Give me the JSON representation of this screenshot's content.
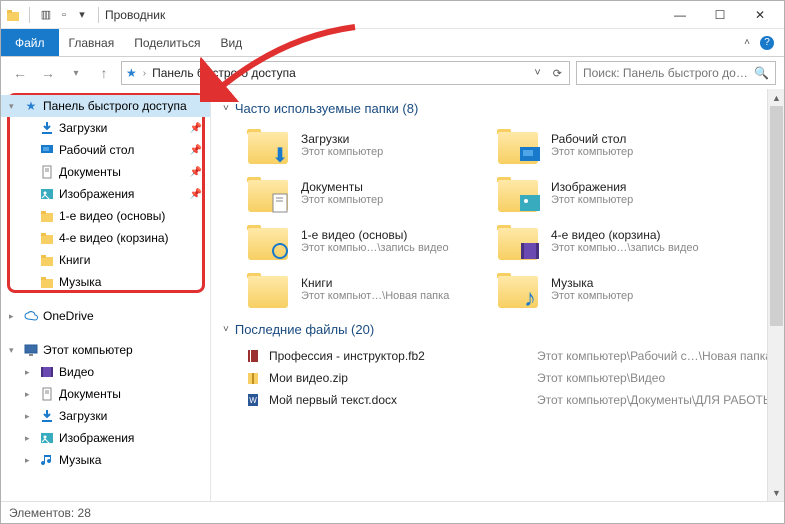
{
  "titlebar": {
    "title": "Проводник"
  },
  "ribbon": {
    "file": "Файл",
    "tabs": [
      "Главная",
      "Поделиться",
      "Вид"
    ]
  },
  "addressbar": {
    "path": "Панель быстрого доступа"
  },
  "search": {
    "placeholder": "Поиск: Панель быстрого до…"
  },
  "tree": {
    "quickaccess": "Панель быстрого доступа",
    "items": [
      {
        "label": "Загрузки",
        "icon": "download",
        "pinned": true
      },
      {
        "label": "Рабочий стол",
        "icon": "desktop",
        "pinned": true
      },
      {
        "label": "Документы",
        "icon": "documents",
        "pinned": true
      },
      {
        "label": "Изображения",
        "icon": "images",
        "pinned": true
      },
      {
        "label": "1-е видео (основы)",
        "icon": "folder",
        "pinned": false
      },
      {
        "label": "4-е видео (корзина)",
        "icon": "folder",
        "pinned": false
      },
      {
        "label": "Книги",
        "icon": "folder",
        "pinned": false
      },
      {
        "label": "Музыка",
        "icon": "folder",
        "pinned": false
      }
    ],
    "onedrive": "OneDrive",
    "thispc": "Этот компьютер",
    "pcitems": [
      {
        "label": "Видео",
        "icon": "video"
      },
      {
        "label": "Документы",
        "icon": "documents"
      },
      {
        "label": "Загрузки",
        "icon": "download"
      },
      {
        "label": "Изображения",
        "icon": "images"
      },
      {
        "label": "Музыка",
        "icon": "music"
      }
    ]
  },
  "content": {
    "frequent_header": "Часто используемые папки (8)",
    "folders": [
      {
        "name": "Загрузки",
        "sub": "Этот компьютер",
        "overlay": "download"
      },
      {
        "name": "Рабочий стол",
        "sub": "Этот компьютер",
        "overlay": "desktop"
      },
      {
        "name": "Документы",
        "sub": "Этот компьютер",
        "overlay": "documents"
      },
      {
        "name": "Изображения",
        "sub": "Этот компьютер",
        "overlay": "images"
      },
      {
        "name": "1-е видео (основы)",
        "sub": "Этот компью…\\запись видео",
        "overlay": "sync"
      },
      {
        "name": "4-е видео (корзина)",
        "sub": "Этот компью…\\запись видео",
        "overlay": "video"
      },
      {
        "name": "Книги",
        "sub": "Этот компьют…\\Новая папка",
        "overlay": "none"
      },
      {
        "name": "Музыка",
        "sub": "Этот компьютер",
        "overlay": "music"
      }
    ],
    "recent_header": "Последние файлы (20)",
    "recent": [
      {
        "name": "Профессия - инструктор.fb2",
        "path": "Этот компьютер\\Рабочий с…\\Новая папка",
        "icon": "book"
      },
      {
        "name": "Мои видео.zip",
        "path": "Этот компьютер\\Видео",
        "icon": "zip"
      },
      {
        "name": "Мой первый текст.docx",
        "path": "Этот компьютер\\Документы\\ДЛЯ РАБОТЫ",
        "icon": "word"
      }
    ]
  },
  "statusbar": {
    "text": "Элементов: 28"
  }
}
